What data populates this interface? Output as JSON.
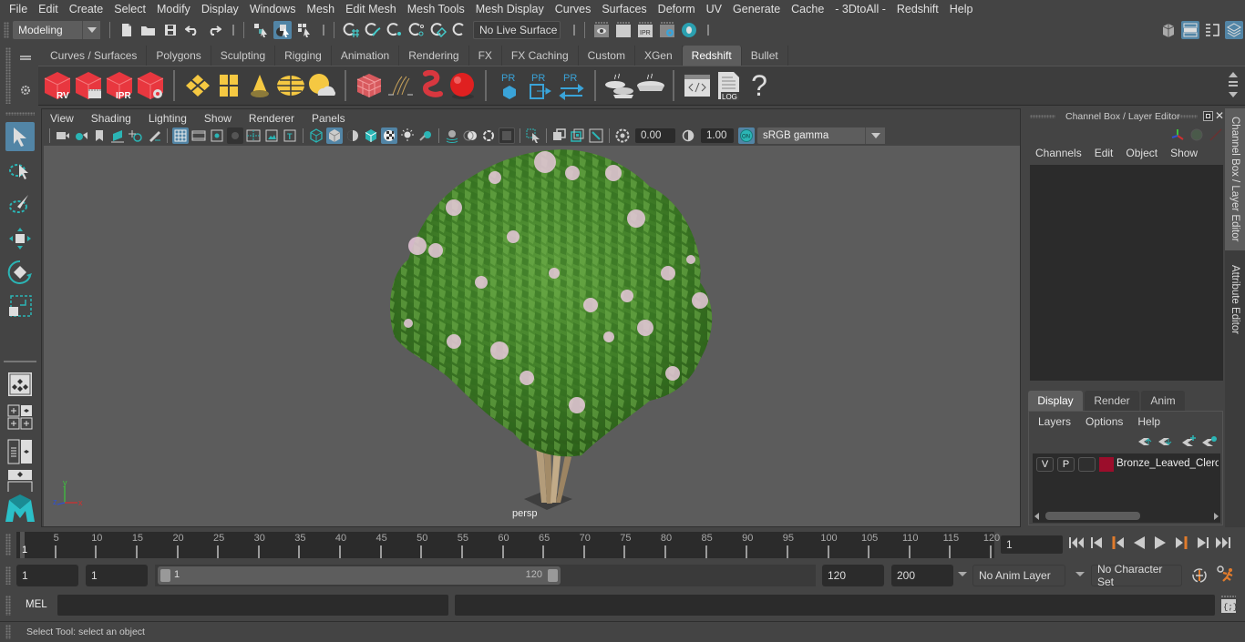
{
  "menubar": {
    "items": [
      "File",
      "Edit",
      "Create",
      "Select",
      "Modify",
      "Display",
      "Windows",
      "Mesh",
      "Edit Mesh",
      "Mesh Tools",
      "Mesh Display",
      "Curves",
      "Surfaces",
      "Deform",
      "UV",
      "Generate",
      "Cache",
      "- 3DtoAll -",
      "Redshift",
      "Help"
    ]
  },
  "statusline": {
    "mode": "Modeling",
    "live_surface": "No Live Surface"
  },
  "shelf": {
    "tabs": [
      "Curves / Surfaces",
      "Polygons",
      "Sculpting",
      "Rigging",
      "Animation",
      "Rendering",
      "FX",
      "FX Caching",
      "Custom",
      "XGen",
      "Redshift",
      "Bullet"
    ],
    "active_tab": "Redshift",
    "icons": [
      {
        "name": "redshift-render-view-icon",
        "label": "RV"
      },
      {
        "name": "redshift-batch-render-icon",
        "label": ""
      },
      {
        "name": "redshift-ipr-icon",
        "label": "IPR"
      },
      {
        "name": "redshift-render-settings-icon",
        "label": ""
      },
      {
        "name": "redshift-area-light-icon",
        "label": ""
      },
      {
        "name": "redshift-portal-light-icon",
        "label": ""
      },
      {
        "name": "redshift-ies-light-icon",
        "label": ""
      },
      {
        "name": "redshift-dome-light-icon",
        "label": ""
      },
      {
        "name": "redshift-sun-sky-icon",
        "label": ""
      },
      {
        "name": "redshift-volume-icon",
        "label": ""
      },
      {
        "name": "redshift-hair-icon",
        "label": ""
      },
      {
        "name": "redshift-material-icon",
        "label": ""
      },
      {
        "name": "redshift-sphere-icon",
        "label": ""
      },
      {
        "name": "redshift-proxy-import-icon",
        "label": "PR"
      },
      {
        "name": "redshift-proxy-export-icon",
        "label": "PR"
      },
      {
        "name": "redshift-proxy-convert-icon",
        "label": "PR"
      },
      {
        "name": "redshift-bake-set-icon",
        "label": ""
      },
      {
        "name": "redshift-bake-icon",
        "label": ""
      },
      {
        "name": "redshift-script-editor-icon",
        "label": ""
      },
      {
        "name": "redshift-log-icon",
        "label": "LOG"
      },
      {
        "name": "redshift-help-icon",
        "label": "?"
      }
    ]
  },
  "viewport": {
    "menus": [
      "View",
      "Shading",
      "Lighting",
      "Show",
      "Renderer",
      "Panels"
    ],
    "exposure": "0.00",
    "gamma": "1.00",
    "color_space": "sRGB gamma",
    "color_mgmt_toggle": "ON",
    "camera_label": "persp",
    "axis_labels": {
      "x": "x",
      "y": "y",
      "z": "z"
    }
  },
  "channel_box": {
    "title": "Channel Box / Layer Editor",
    "menus": [
      "Channels",
      "Edit",
      "Object",
      "Show"
    ]
  },
  "layer_editor": {
    "tabs": [
      "Display",
      "Render",
      "Anim"
    ],
    "active_tab": "Display",
    "menus": [
      "Layers",
      "Options",
      "Help"
    ],
    "layers": [
      {
        "visible": "V",
        "playback": "P",
        "name": "Bronze_Leaved_Clerod",
        "color": "#9b0d2b"
      }
    ]
  },
  "side_tabs": [
    "Channel Box / Layer Editor",
    "Attribute Editor"
  ],
  "timeline": {
    "ticks": [
      5,
      10,
      15,
      20,
      25,
      30,
      35,
      40,
      45,
      50,
      55,
      60,
      65,
      70,
      75,
      80,
      85,
      90,
      95,
      100,
      105,
      110,
      115,
      120
    ],
    "start": 1,
    "end": 120,
    "current_frame_marker": "1",
    "current_frame": "1"
  },
  "range": {
    "start_time": "1",
    "playback_start": "1",
    "range_min_label": "1",
    "range_max_label": "120",
    "playback_end": "120",
    "end_time": "200",
    "anim_layer": "No Anim Layer",
    "character_set": "No Character Set"
  },
  "command_line": {
    "language": "MEL",
    "input": "",
    "result": ""
  },
  "help_line": {
    "text": "Select Tool: select an object"
  },
  "colors": {
    "accent": "#5285a6",
    "background": "#444444",
    "viewport": "#5c5c5c",
    "redshift_red": "#e8373f",
    "light_yellow": "#f5c842",
    "proxy_blue": "#3aa3d8",
    "timeline_orange": "#e07b2c"
  }
}
